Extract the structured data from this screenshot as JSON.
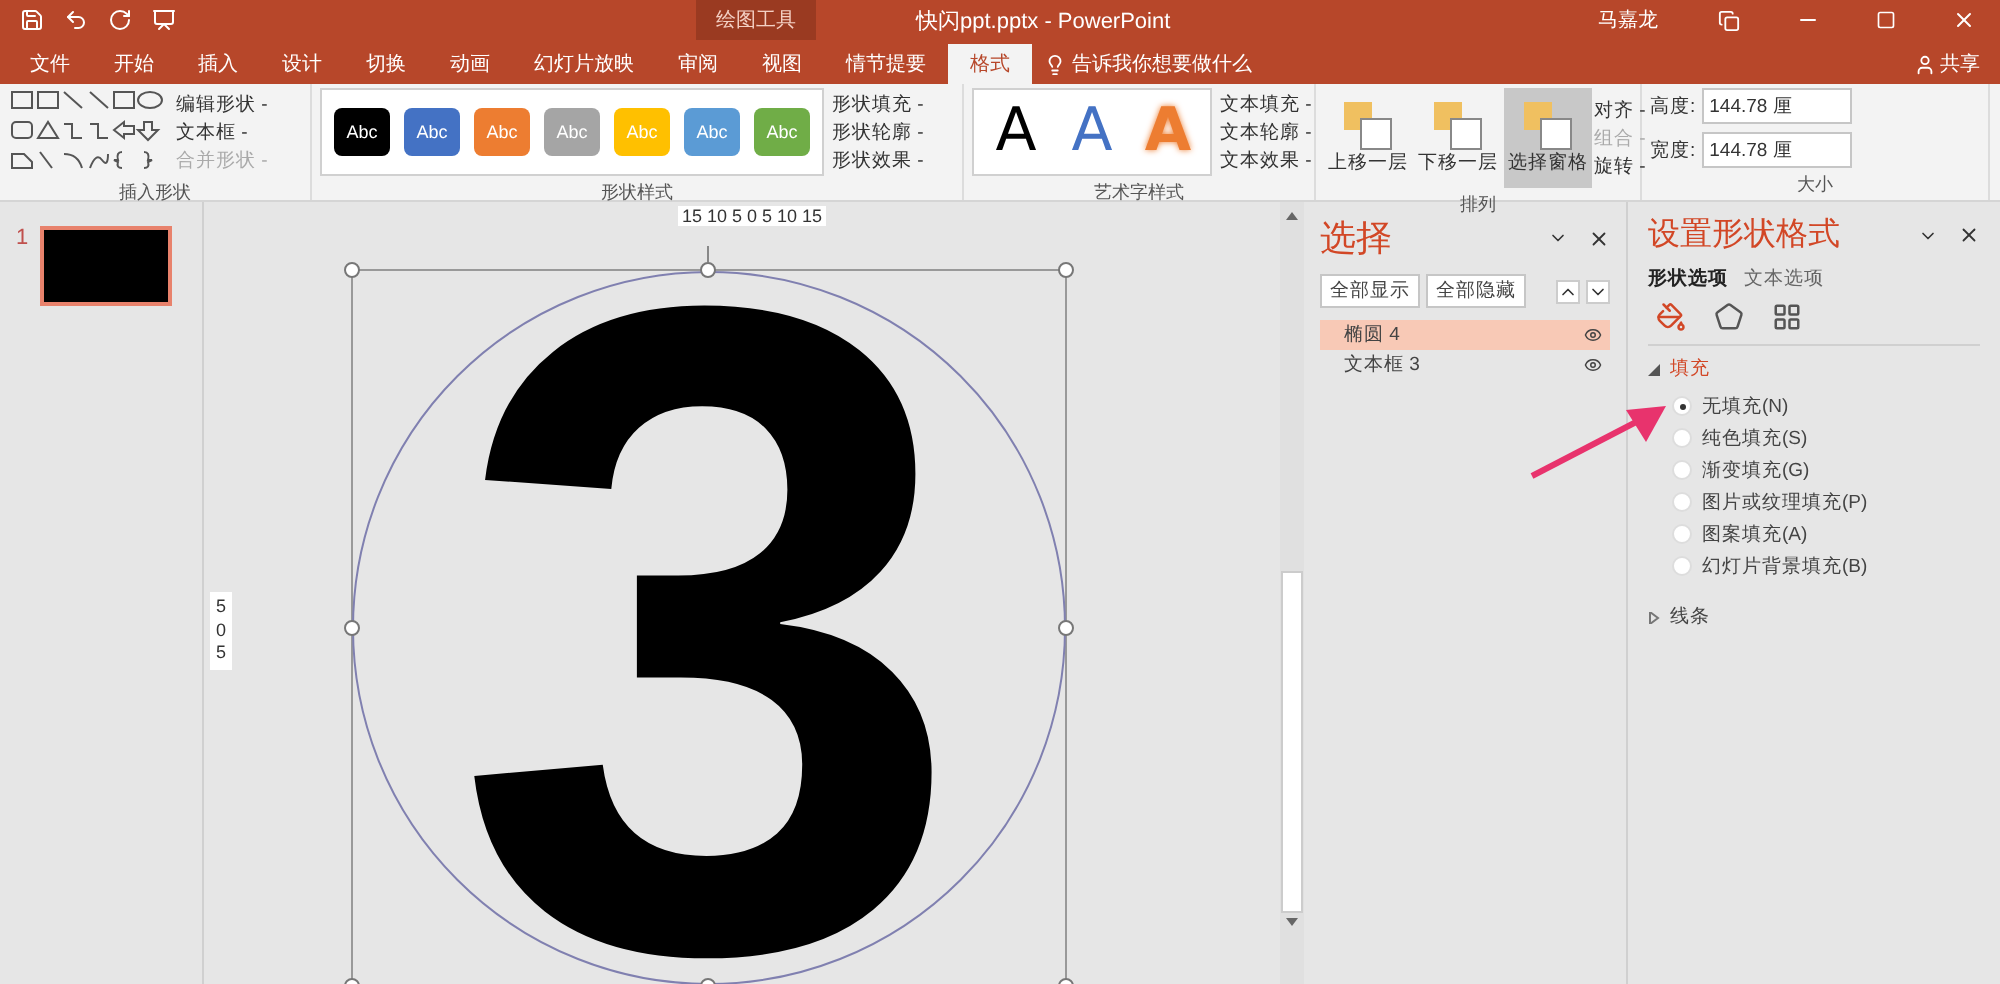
{
  "title_bar": {
    "context_label": "绘图工具",
    "title": "快闪ppt.pptx - PowerPoint",
    "user": "马嘉龙"
  },
  "tabs": [
    {
      "label": "文件",
      "selected": false
    },
    {
      "label": "开始",
      "selected": false
    },
    {
      "label": "插入",
      "selected": false
    },
    {
      "label": "设计",
      "selected": false
    },
    {
      "label": "切换",
      "selected": false
    },
    {
      "label": "动画",
      "selected": false
    },
    {
      "label": "幻灯片放映",
      "selected": false
    },
    {
      "label": "审阅",
      "selected": false
    },
    {
      "label": "视图",
      "selected": false
    },
    {
      "label": "情节提要",
      "selected": false
    },
    {
      "label": "格式",
      "selected": true
    }
  ],
  "tell_me": "告诉我你想要做什么",
  "share": "共享",
  "ribbon": {
    "insert_shapes": {
      "label": "插入形状",
      "commands": [
        {
          "label": "编辑形状 -",
          "disabled": false
        },
        {
          "label": "文本框 -",
          "disabled": false
        },
        {
          "label": "合并形状 -",
          "disabled": true
        }
      ]
    },
    "shape_styles": {
      "label": "形状样式",
      "presets": [
        {
          "label": "Abc",
          "color": "#000000"
        },
        {
          "label": "Abc",
          "color": "#4472c4"
        },
        {
          "label": "Abc",
          "color": "#ed7d31"
        },
        {
          "label": "Abc",
          "color": "#a5a5a5"
        },
        {
          "label": "Abc",
          "color": "#ffc000"
        },
        {
          "label": "Abc",
          "color": "#5b9bd5"
        },
        {
          "label": "Abc",
          "color": "#70ad47"
        }
      ],
      "commands": [
        "形状填充 -",
        "形状轮廓 -",
        "形状效果 -"
      ]
    },
    "wordart": {
      "label": "艺术字样式",
      "samples": [
        {
          "label": "A",
          "kind": "solid",
          "color": "#000000"
        },
        {
          "label": "A",
          "kind": "solid",
          "color": "#4472c4"
        },
        {
          "label": "A",
          "kind": "outline",
          "color": "#ed7d31"
        }
      ],
      "commands": [
        "文本填充 -",
        "文本轮廓 -",
        "文本效果 -"
      ]
    },
    "arrange": {
      "label": "排列",
      "big": [
        {
          "label": "上移一层",
          "selected": false
        },
        {
          "label": "下移一层",
          "selected": false
        },
        {
          "label": "选择窗格",
          "selected": true
        }
      ],
      "small": [
        {
          "label": "对齐 -",
          "disabled": false
        },
        {
          "label": "组合 -",
          "disabled": true
        },
        {
          "label": "旋转 -",
          "disabled": false
        }
      ]
    },
    "size": {
      "label": "大小",
      "fields": [
        {
          "label": "高度:",
          "value": "144.78 厘"
        },
        {
          "label": "宽度:",
          "value": "144.78 厘"
        }
      ]
    }
  },
  "slides": [
    {
      "number": "1",
      "selected": true
    }
  ],
  "canvas": {
    "ruler_h": "15 10 5 0 5 10 15",
    "ruler_v": "5 0 5",
    "slide_text": "3"
  },
  "selection_pane": {
    "title": "选择",
    "buttons": [
      "全部显示",
      "全部隐藏"
    ],
    "items": [
      {
        "label": "椭圆 4",
        "selected": true
      },
      {
        "label": "文本框 3",
        "selected": false
      }
    ]
  },
  "format_pane": {
    "title": "设置形状格式",
    "tabs": [
      {
        "label": "形状选项",
        "selected": true
      },
      {
        "label": "文本选项",
        "selected": false
      }
    ],
    "sections": [
      {
        "label": "填充",
        "expanded": true,
        "options": [
          {
            "label": "无填充(N)",
            "selected": true
          },
          {
            "label": "纯色填充(S)",
            "selected": false
          },
          {
            "label": "渐变填充(G)",
            "selected": false
          },
          {
            "label": "图片或纹理填充(P)",
            "selected": false
          },
          {
            "label": "图案填充(A)",
            "selected": false
          },
          {
            "label": "幻灯片背景填充(B)",
            "selected": false
          }
        ]
      },
      {
        "label": "线条",
        "expanded": false
      }
    ]
  }
}
